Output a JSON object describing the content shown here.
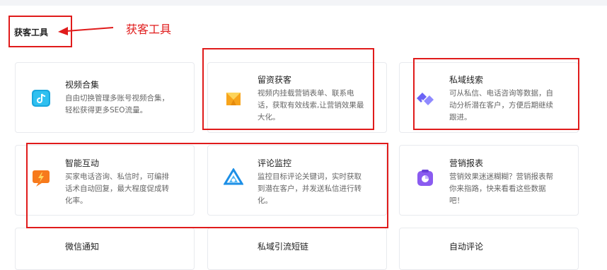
{
  "section": {
    "title": "获客工具"
  },
  "annotation": {
    "label": "获客工具",
    "color": "#e01b1b"
  },
  "cards": [
    {
      "title": "视频合集",
      "desc": [
        "自由切换管理多账号视频合集，",
        "轻松获得更多SEO流量。"
      ],
      "icon": "video-collection-icon"
    },
    {
      "title": "留资获客",
      "desc": [
        "视频内挂载营销表单、联系电",
        "话，获取有效线索,让营销效果最",
        "大化。"
      ],
      "icon": "lead-capture-icon"
    },
    {
      "title": "私域线索",
      "desc": [
        "可从私信、电话咨询等数据，自",
        "动分析潜在客户，方便后期继续",
        "跟进。"
      ],
      "icon": "handshake-icon"
    },
    {
      "title": "智能互动",
      "desc": [
        "买家电话咨询、私信时，可编排",
        "话术自动回复，最大程度促成转",
        "化率。"
      ],
      "icon": "smart-interaction-icon"
    },
    {
      "title": "评论监控",
      "desc": [
        "监控目标评论关键词，实时获取",
        "到潜在客户，并发送私信进行转",
        "化。"
      ],
      "icon": "comment-monitor-icon"
    },
    {
      "title": "营销报表",
      "desc": [
        "营销效果迷迷糊糊？营销报表帮",
        "你来指路，快来看看这些数据",
        "吧！"
      ],
      "icon": "marketing-report-icon"
    },
    {
      "title": "微信通知",
      "desc": [],
      "icon": "wechat-notify-icon"
    },
    {
      "title": "私域引流短链",
      "desc": [],
      "icon": "short-link-icon"
    },
    {
      "title": "自动评论",
      "desc": [],
      "icon": "auto-comment-icon"
    }
  ]
}
